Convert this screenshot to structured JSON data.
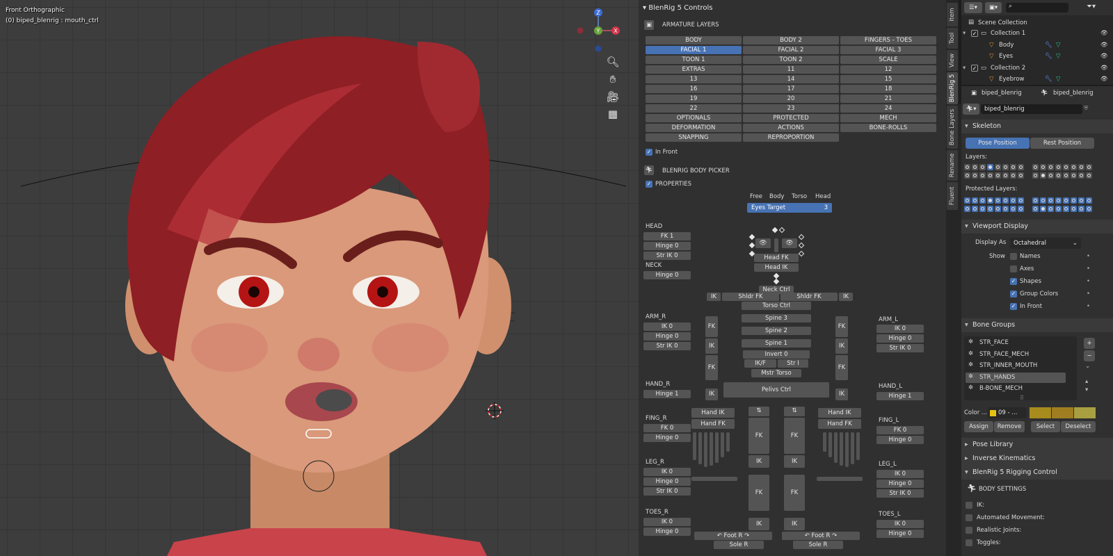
{
  "viewport": {
    "view_name": "Front Orthographic",
    "object_info": "(0) biped_blenrig : mouth_ctrl",
    "gizmo_axes": {
      "z": "Z",
      "y": "Y",
      "x": "X"
    },
    "nav_icons": [
      "zoom-icon",
      "hand-pan-icon",
      "camera-icon",
      "grid-icon"
    ]
  },
  "controls": {
    "panel_title": "BlenRig 5 Controls",
    "armature_layers_title": "ARMATURE LAYERS",
    "layer_buttons": [
      [
        "BODY",
        "BODY 2",
        "FINGERS - TOES"
      ],
      [
        "FACIAL 1",
        "FACIAL 2",
        "FACIAL 3"
      ],
      [
        "TOON 1",
        "TOON 2",
        "SCALE"
      ],
      [
        "EXTRAS",
        "11",
        "12"
      ],
      [
        "13",
        "14",
        "15"
      ],
      [
        "16",
        "17",
        "18"
      ],
      [
        "19",
        "20",
        "21"
      ],
      [
        "22",
        "23",
        "24"
      ],
      [
        "OPTIONALS",
        "PROTECTED",
        "MECH"
      ],
      [
        "DEFORMATION",
        "ACTIONS",
        "BONE-ROLLS"
      ],
      [
        "SNAPPING",
        "REPROPORTION",
        ""
      ]
    ],
    "active_layer": "FACIAL 1",
    "in_front_label": "In Front",
    "body_picker_title": "BLENRIG BODY PICKER",
    "properties_label": "PROPERTIES",
    "head_modes": [
      "Free",
      "Body",
      "Torso",
      "Head"
    ],
    "eyes_target_label": "Eyes Target",
    "eyes_target_value": "3",
    "left_column": {
      "head_title": "HEAD",
      "head_items": [
        "FK 1",
        "Hinge 0",
        "Str IK 0"
      ],
      "neck_title": "NECK",
      "neck_items": [
        "Hinge 0"
      ],
      "arm_r_title": "ARM_R",
      "arm_r_items": [
        "IK 0",
        "Hinge 0",
        "Str IK 0"
      ],
      "hand_r_title": "HAND_R",
      "hand_r_items": [
        "Hinge 1"
      ],
      "fing_r_title": "FING_R",
      "fing_r_items": [
        "FK 0",
        "Hinge 0"
      ],
      "leg_r_title": "LEG_R",
      "leg_r_items": [
        "IK 0",
        "Hinge 0",
        "Str IK 0"
      ],
      "toes_r_title": "TOES_R",
      "toes_r_items": [
        "IK 0",
        "Hinge 0"
      ]
    },
    "right_column": {
      "arm_l_title": "ARM_L",
      "arm_l_items": [
        "IK 0",
        "Hinge 0",
        "Str IK 0"
      ],
      "hand_l_title": "HAND_L",
      "hand_l_items": [
        "Hinge 1"
      ],
      "fing_l_title": "FING_L",
      "fing_l_items": [
        "FK 0",
        "Hinge 0"
      ],
      "leg_l_title": "LEG_L",
      "leg_l_items": [
        "IK 0",
        "Hinge 0",
        "Str IK 0"
      ],
      "toes_l_title": "TOES_L",
      "toes_l_items": [
        "IK 0",
        "Hinge 0"
      ]
    },
    "picker": {
      "head_fk": "Head FK",
      "head_ik": "Head IK",
      "neck_ctrl": "Neck Ctrl",
      "ik_small": "IK",
      "shldr_fk_r": "Shldr FK",
      "shldr_fk_l": "Shldr FK",
      "torso_ctrl": "Torso Ctrl",
      "spine3": "Spine 3",
      "spine2": "Spine 2",
      "spine1": "Spine 1",
      "invert": "Invert 0",
      "ikf": "IK/F",
      "str_i": "Str I",
      "mstr_torso": "Mstr Torso",
      "pelvis_ctrl": "Pelivs Ctrl",
      "fk": "FK",
      "ik": "IK",
      "hand_ik": "Hand IK",
      "hand_fk": "Hand FK",
      "foot_r": "Foot R",
      "sole_r": "Sole R"
    }
  },
  "vertical_tabs": [
    "Item",
    "Tool",
    "View",
    "BlenRig 5",
    "Bone Layers",
    "Rename",
    "Fluent"
  ],
  "active_vertical_tab": "BlenRig 5",
  "outliner": {
    "root": "Scene Collection",
    "rows": [
      {
        "label": "Collection 1",
        "kind": "collection"
      },
      {
        "label": "Body",
        "kind": "object"
      },
      {
        "label": "Eyes",
        "kind": "object"
      },
      {
        "label": "Collection 2",
        "kind": "collection"
      },
      {
        "label": "Eyebrow",
        "kind": "object"
      }
    ]
  },
  "properties": {
    "breadcrumb_1": "biped_blenrig",
    "breadcrumb_2": "biped_blenrig",
    "data_name": "biped_blenrig",
    "skeleton_title": "Skeleton",
    "pose_position": "Pose Position",
    "rest_position": "Rest Position",
    "layers_label": "Layers:",
    "protected_layers_label": "Protected Layers:",
    "viewport_display_title": "Viewport Display",
    "display_as_label": "Display As",
    "display_as_value": "Octahedral",
    "show_label": "Show",
    "show_options": [
      {
        "label": "Names",
        "checked": false
      },
      {
        "label": "Axes",
        "checked": false
      },
      {
        "label": "Shapes",
        "checked": true
      },
      {
        "label": "Group Colors",
        "checked": true
      },
      {
        "label": "In Front",
        "checked": true
      }
    ],
    "bone_groups_title": "Bone Groups",
    "bone_groups": [
      "STR_FACE",
      "STR_FACE_MECH",
      "STR_INNER_MOUTH",
      "STR_HANDS",
      "B-BONE_MECH"
    ],
    "active_bone_group": "STR_HANDS",
    "color_label": "Color ...",
    "color_value": "09 - ...",
    "assign": "Assign",
    "remove": "Remove",
    "select": "Select",
    "deselect": "Deselect",
    "pose_library": "Pose Library",
    "inverse_kinematics": "Inverse Kinematics",
    "rigging_control": "BlenRig 5 Rigging Control",
    "body_settings": "BODY SETTINGS",
    "settings": [
      "IK:",
      "Automated Movement:",
      "Realistic Joints:",
      "Toggles:"
    ]
  }
}
